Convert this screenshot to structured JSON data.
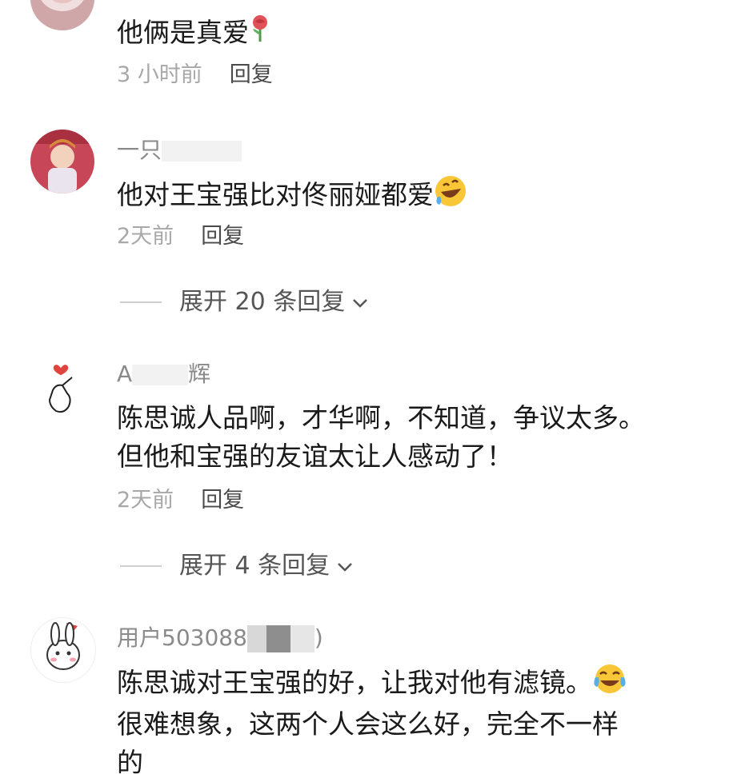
{
  "comments": [
    {
      "content": "他俩是真爱",
      "time": "3 小时前",
      "reply_label": "回复",
      "emoji": "rose-emoji"
    },
    {
      "username": "一只",
      "content": "他对王宝强比对佟丽娅都爱",
      "time": "2天前",
      "reply_label": "回复",
      "expand_label": "展开 20 条回复",
      "emoji": "rofl-emoji"
    },
    {
      "username": "A",
      "username_tail": "辉",
      "content_lines": [
        "陈思诚人品啊，才华啊，不知道，争议太多。",
        "但他和宝强的友谊太让人感动了！"
      ],
      "time": "2天前",
      "reply_label": "回复",
      "expand_label": "展开 4 条回复"
    },
    {
      "username": "用户503088",
      "username_tail": ")",
      "content_lines": [
        "陈思诚对王宝强的好，让我对他有滤镜。",
        "很难想象，这两个人会这么好，完全不一样",
        "的"
      ],
      "emoji": "joy-emoji"
    }
  ]
}
